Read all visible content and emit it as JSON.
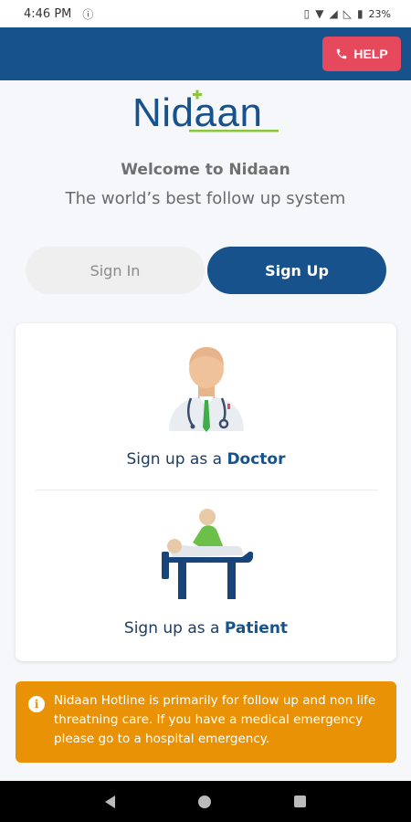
{
  "status_bar": {
    "time": "4:46 PM",
    "battery": "23%"
  },
  "header": {
    "help_label": "HELP"
  },
  "logo": {
    "text": "Nidaan"
  },
  "welcome": {
    "title": "Welcome to Nidaan",
    "subtitle": "The world’s best follow up system"
  },
  "tabs": [
    {
      "label": "Sign In"
    },
    {
      "label": "Sign Up"
    }
  ],
  "options": {
    "doctor": {
      "prefix": "Sign up as a ",
      "bold": "Doctor"
    },
    "patient": {
      "prefix": "Sign up as a ",
      "bold": "Patient"
    }
  },
  "banner": {
    "text": "Nidaan Hotline is primarily for follow up and non life threatning care. If you have a medical emergency please go to a hospital emergency."
  },
  "colors": {
    "primary": "#17528c",
    "help": "#e6485c",
    "warning": "#ea9205"
  }
}
